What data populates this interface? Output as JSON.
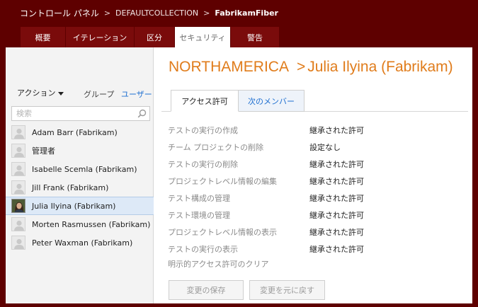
{
  "breadcrumb": {
    "root": "コントロール パネル",
    "separator": ">",
    "collection": "DEFAULTCOLLECTION",
    "project": "FabrikamFiber"
  },
  "tabs": [
    {
      "label": "概要",
      "active": false
    },
    {
      "label": "イテレーション",
      "active": false
    },
    {
      "label": "区分",
      "active": false
    },
    {
      "label": "セキュリティ",
      "active": true
    },
    {
      "label": "警告",
      "active": false
    }
  ],
  "left_panel": {
    "actions_label": "アクション",
    "filter_groups": "グループ",
    "filter_users": "ユーザー",
    "search_placeholder": "検索",
    "members": [
      {
        "name": "Adam Barr (Fabrikam)",
        "avatar": "placeholder-avatar-icon",
        "selected": false
      },
      {
        "name": "管理者",
        "avatar": "placeholder-avatar-icon",
        "selected": false
      },
      {
        "name": "Isabelle Scemla (Fabrikam)",
        "avatar": "placeholder-avatar-icon",
        "selected": false
      },
      {
        "name": "Jill Frank (Fabrikam)",
        "avatar": "placeholder-avatar-icon",
        "selected": false
      },
      {
        "name": "Julia Ilyina (Fabrikam)",
        "avatar": "user-photo",
        "selected": true
      },
      {
        "name": "Morten Rasmussen (Fabrikam)",
        "avatar": "placeholder-avatar-icon",
        "selected": false
      },
      {
        "name": "Peter Waxman (Fabrikam)",
        "avatar": "placeholder-avatar-icon",
        "selected": false
      }
    ]
  },
  "detail": {
    "title_scope": "NORTHAMERICA",
    "title_separator": ">",
    "title_user": "Julia Ilyina (Fabrikam)",
    "tab_permissions": "アクセス許可",
    "tab_member_of": "次のメンバー",
    "permissions": [
      {
        "name": "テストの実行の作成",
        "value": "継承された許可"
      },
      {
        "name": "チーム プロジェクトの削除",
        "value": "設定なし"
      },
      {
        "name": "テストの実行の削除",
        "value": "継承された許可"
      },
      {
        "name": "プロジェクトレベル情報の編集",
        "value": "継承された許可"
      },
      {
        "name": "テスト構成の管理",
        "value": "継承された許可"
      },
      {
        "name": "テスト環境の管理",
        "value": "継承された許可"
      },
      {
        "name": "プロジェクトレベル情報の表示",
        "value": "継承された許可"
      },
      {
        "name": "テストの実行の表示",
        "value": "継承された許可"
      }
    ],
    "clear_link": "明示的アクセス許可のクリア",
    "save_button": "変更の保存",
    "undo_button": "変更を元に戻す"
  },
  "colors": {
    "header_bg": "#5e0000",
    "tab_bg": "#7a0b0b",
    "title": "#e07c1b",
    "link": "#1e6fd0",
    "selection": "#dde9f7"
  }
}
